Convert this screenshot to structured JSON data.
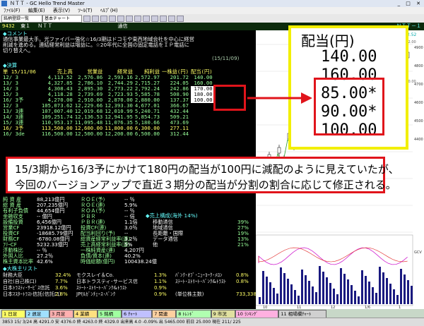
{
  "window": {
    "title": "ＮＴＴ - GC Hello Trend Master"
  },
  "menu": [
    "ﾌｧｲﾙ(F)",
    "編集(E)",
    "表示(V)",
    "ﾂｰﾙ(T)",
    "ﾍﾙﾌﾟ(H)"
  ],
  "toolbar": {
    "list_combo": "銘柄登録一覧",
    "chart_combo": "基本チャート"
  },
  "infobar": {
    "code": "9432",
    "market": "東１",
    "name": "ＮＴＴ",
    "sector": "通信",
    "right_tag": "ＮＴＴ－１"
  },
  "company": {
    "section_label": "◆コメント",
    "comment_lines": [
      "通信事業最大手。光ファイバー強化☆16/3期はドコモや東西地域会社を中心に経営",
      "削減を進める。連結経常利益は増益に。☆20年代に全国の固定電話をＩＰ電話に",
      "切り替えへ。"
    ],
    "comment_date": "(15/11/09)"
  },
  "financials": {
    "section_label": "◆決算",
    "header": [
      "単 15/11/06",
      "売上高",
      "営業益",
      "経常益",
      "純利益",
      "一株益(円)",
      "配当(円)"
    ],
    "rows": [
      [
        "12/ 3",
        "4,113.52",
        "2,576.86",
        "2,593.16",
        "2,572.97",
        "201.72",
        "140.00"
      ],
      [
        "13/ 3",
        "4,327.85",
        "2,786.10",
        "2,744.29",
        "2,715.27",
        "224.05",
        "160.00"
      ],
      [
        "14/ 3",
        "4,308.43",
        "2,895.30",
        "2,773.22",
        "2,792.24",
        "242.86",
        "170.00"
      ],
      [
        "15/ 3",
        "4,118.28",
        "2,739.69",
        "2,723.93",
        "5,585.78",
        "508.90",
        "180.00"
      ],
      [
        "16/ 3予",
        "4,270.00",
        "2,910.00",
        "2,870.00",
        "2,880.00",
        "137.37",
        "100.00"
      ],
      [
        "12/ 3",
        "105,073.62",
        "12,229.66",
        "12,393.30",
        "4,677.01",
        "366.67",
        ""
      ],
      [
        "13/ 3連",
        "107,007.40",
        "12,019.68",
        "12,010.99",
        "5,240.71",
        "432.44",
        ""
      ],
      [
        "14/ 3連",
        "109,251.74",
        "12,136.53",
        "12,941.95",
        "5,854.73",
        "509.21",
        ""
      ],
      [
        "15/ 3連",
        "110,953.17",
        "11,095.48",
        "11,076.35",
        "5,180.66",
        "473.69",
        ""
      ],
      [
        "16/ 3予",
        "113,500.00",
        "12,600.00",
        "11,800.00",
        "6,300.00",
        "277.11",
        ""
      ],
      [
        "16/ 3de",
        "116,500.00",
        "12,500.00",
        "12,200.00",
        "6,500.00",
        "312.44",
        ""
      ]
    ]
  },
  "indicators": [
    [
      "純 資 産",
      "88,213億円",
      "ＲＯＥ(予)",
      "-- ％"
    ],
    [
      "総 資 産",
      "207,235億円",
      "ＲＯＥ(連)",
      "5.9%"
    ],
    [
      "有利子負債",
      "44,654億円",
      "ＲＯＡ(予)",
      "-- ％"
    ],
    [
      "金融収支",
      "-- 億円",
      "ＰＢＲ",
      "-- 倍"
    ],
    [
      "設備投資",
      "6,456億円",
      "ＰＢＲ(連)",
      "1.1倍"
    ],
    [
      "営業CF",
      "23918.12億円",
      "投資CF(連)",
      "3.0％"
    ],
    [
      "投資CF",
      "-18685.79億円",
      "配当利回り(予)",
      "--"
    ],
    [
      "財務CF",
      "-6780.08億円",
      "総資産経常利益率(連)",
      "3.2％"
    ],
    [
      "ﾌﾘｰCF",
      "5232.33億円",
      "売上高経常利益率(連)",
      "5%"
    ],
    [
      "浮動株比",
      "-- ％",
      "一株純資産(連)",
      "4,207円"
    ],
    [
      "外国人比",
      "27.2％",
      "負債/資本(連)",
      "40.2%"
    ],
    [
      "株主資本比率",
      "42.6%",
      "時価総額(億円)",
      "100438.24億"
    ]
  ],
  "segments": {
    "label": "◆売上構成(海外 14%)",
    "items": [
      [
        "移動通信",
        "39%"
      ],
      [
        "地域通信",
        "27%"
      ],
      [
        "長距離・国際",
        "19%"
      ],
      [
        "データ通信",
        "13%"
      ],
      [
        "他",
        "21%"
      ]
    ]
  },
  "shareholders": {
    "label": "◆大株主リスト",
    "items": [
      [
        "財務大臣",
        "32.4%",
        "モクスレイ＆Co.",
        "1.3%",
        "ﾊﾞﾝｸ･ｵﾌﾞ･ﾆｭｰﾖｰｸ･ﾒﾛﾝ",
        "0.8%"
      ],
      [
        "自社(自己株口)",
        "7.7%",
        "日本トラスティ･サービス信",
        "1.1%",
        "ｽﾃｰﾄ･ｽﾄﾘｰﾄ･ﾊﾞﾝｸ&ﾄﾗｽﾄ",
        "0.8%"
      ],
      [
        "日本ﾄﾗｽﾃｨ･ｻｰﾋﾞｽ信託",
        "3.6%",
        "ｽﾃｰﾄ･ｽﾄﾘｰﾄ･ﾊﾞﾝｸ&ﾄﾗｽﾄ",
        "0.9%",
        "",
        ""
      ],
      [
        "日本ﾏｽﾀｰﾄﾗｽﾄ信託(信託口)",
        "2.8%",
        "JPﾓﾙｶﾞﾝﾁｪｰｽ･ﾊﾞﾝｸ",
        "0.9%",
        "(単位株主数)",
        "733,338"
      ]
    ]
  },
  "tabs": [
    "1 日足",
    "2 週足",
    "3 月足",
    "4 業績",
    "5 銘柄",
    "6 ﾁｬｰﾄ",
    "7 関連",
    "8 ﾄﾚﾝﾄﾞ",
    "9 市況",
    "10 ﾗﾝｷﾝｸﾞ",
    "11 相場欄ﾁｬｰﾄ"
  ],
  "statusbar": {
    "text": "3853 15/ 3/24 高 4291.0 安 4376.0 終 4263.0 終 4329.0 出来高 4.0 -0.09% 出 5465.000 前日 25.000 現在 211/ 225"
  },
  "chart": {
    "price_labels": [
      "4900",
      "4800",
      "4700",
      "4600",
      "4500",
      "4400"
    ],
    "price_values_top": [
      "6002.00",
      "4750.00"
    ],
    "right_tag": "2.52",
    "gcv_label": "GCV",
    "x_labels": [
      "10",
      "11",
      "12",
      "1/6",
      "1"
    ]
  },
  "annotation": {
    "banner_line1": "15/3期から16/3予にかけて180円の配当が100円に減配のように見えていたが、",
    "banner_line2": "今回のバージョンアップで直近３期分の配当が分割の割合に応じて修正される。",
    "yellow_title": "配当(円)",
    "yellow_values": [
      "140.00",
      "160.00",
      "85.00*",
      "90.00*",
      "100.00"
    ]
  },
  "colors": {
    "annotation_red": "#e0141b",
    "annotation_yellow": "#f2ef00",
    "panel_bg": "#000000",
    "text_green": "#7fd07f"
  }
}
